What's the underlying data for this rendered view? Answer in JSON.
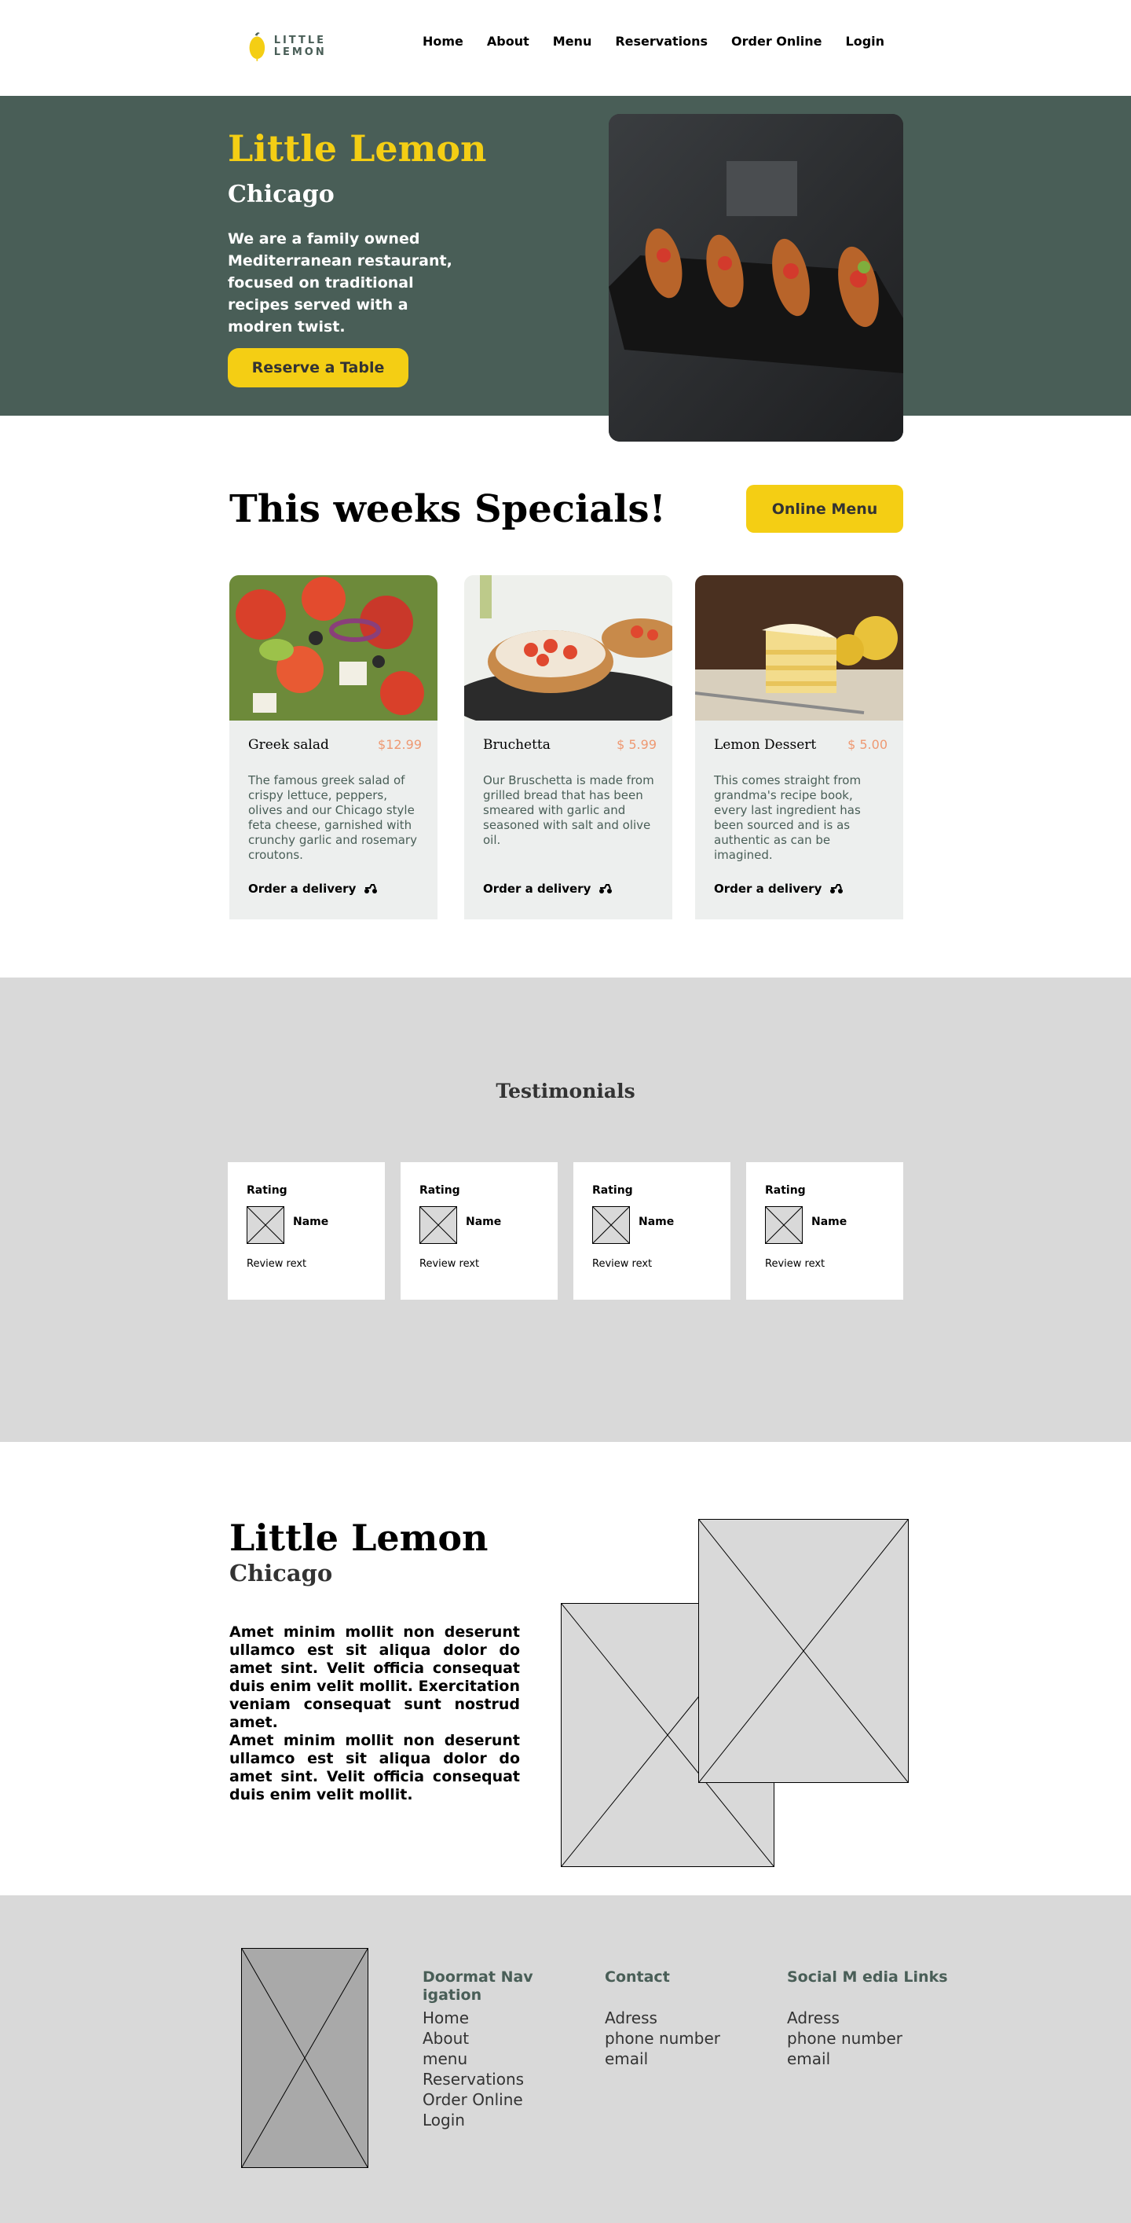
{
  "nav": {
    "brand": "LITTLE LEMON",
    "items": [
      "Home",
      "About",
      "Menu",
      "Reservations",
      "Order Online",
      "Login"
    ]
  },
  "hero": {
    "title": "Little Lemon",
    "subtitle": "Chicago",
    "description": "We are a family owned Mediterranean restaurant, focused on traditional recipes served with a modren twist.",
    "button": "Reserve a Table"
  },
  "specials": {
    "title": "This weeks Specials!",
    "button": "Online Menu",
    "cards": [
      {
        "name": "Greek salad",
        "price": "$12.99",
        "description": "The famous greek salad of crispy lettuce, peppers, olives and our Chicago style feta cheese, garnished with crunchy garlic and rosemary croutons.",
        "order": "Order a delivery"
      },
      {
        "name": "Bruchetta",
        "price": "$ 5.99",
        "description": "Our Bruschetta is made from grilled bread that has been smeared with garlic and seasoned with salt and olive oil.",
        "order": "Order a delivery"
      },
      {
        "name": "Lemon Dessert",
        "price": "$ 5.00",
        "description": "This comes straight from grandma's recipe book, every last ingredient has been sourced and is as authentic as can be imagined.",
        "order": "Order a delivery"
      }
    ]
  },
  "testimonials": {
    "title": "Testimonials",
    "cards": [
      {
        "rating": "Rating",
        "name": "Name",
        "review": "Review rext"
      },
      {
        "rating": "Rating",
        "name": "Name",
        "review": "Review rext"
      },
      {
        "rating": "Rating",
        "name": "Name",
        "review": "Review rext"
      },
      {
        "rating": "Rating",
        "name": "Name",
        "review": "Review rext"
      }
    ]
  },
  "about": {
    "title": "Little Lemon",
    "subtitle": "Chicago",
    "paragraph1": "Amet minim mollit non deserunt ullamco est sit aliqua dolor do amet sint. Velit officia consequat duis enim velit mollit. Exercitation veniam consequat sunt nostrud amet.",
    "paragraph2": "Amet minim mollit non deserunt ullamco est sit aliqua dolor do amet sint. Velit officia consequat duis enim velit mollit."
  },
  "footer": {
    "columns": [
      {
        "heading": "Doormat Nav igation",
        "items": [
          "Home",
          "About",
          "menu",
          "Reservations",
          "Order Online",
          "Login"
        ]
      },
      {
        "heading": "Contact",
        "items": [
          "Adress",
          "phone number",
          "email"
        ]
      },
      {
        "heading": "Social M edia Links",
        "items": [
          "Adress",
          "phone number",
          "email"
        ]
      }
    ]
  },
  "colors": {
    "primary_green": "#495e57",
    "primary_yellow": "#f4ce14",
    "price_salmon": "#ee9972",
    "highlight": "#edefee",
    "placeholder_gray": "#d9d9d9"
  }
}
